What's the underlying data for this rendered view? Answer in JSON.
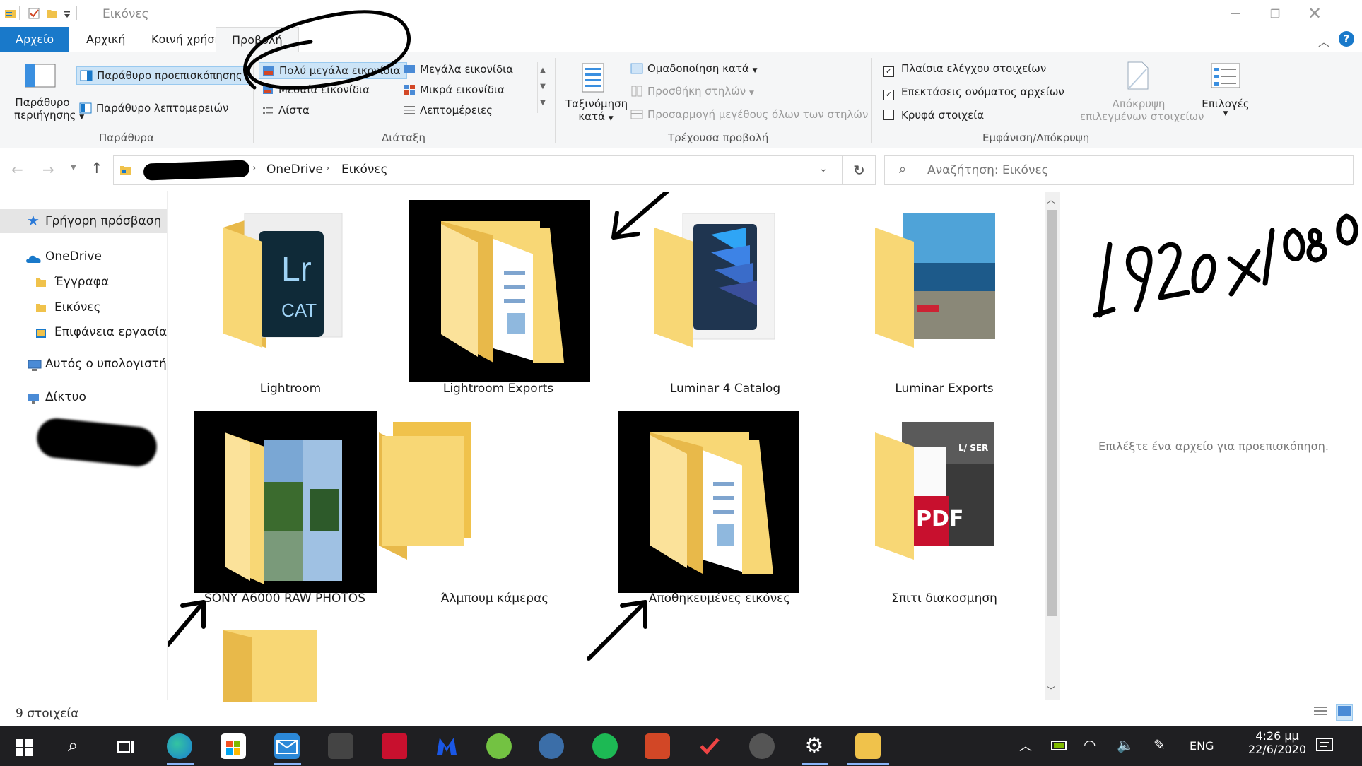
{
  "window": {
    "title": "Εικόνες",
    "help": "?"
  },
  "tabs": {
    "file": "Αρχείο",
    "home": "Αρχική",
    "share": "Κοινή χρήση",
    "view": "Προβολή"
  },
  "ribbon": {
    "panes": {
      "nav_pane_line1": "Παράθυρο",
      "nav_pane_line2": "περιήγησης",
      "preview_pane": "Παράθυρο προεπισκόπησης",
      "details_pane": "Παράθυρο λεπτομερειών",
      "group": "Παράθυρα"
    },
    "layout": {
      "xl_icons": "Πολύ μεγάλα εικονίδια",
      "large_icons": "Μεγάλα εικονίδια",
      "medium_icons": "Μεσαία εικονίδια",
      "small_icons": "Μικρά εικονίδια",
      "list": "Λίστα",
      "details": "Λεπτομέρειες",
      "group": "Διάταξη"
    },
    "current_view": {
      "sort_line1": "Ταξινόμηση",
      "sort_line2": "κατά",
      "group_by": "Ομαδοποίηση κατά",
      "add_columns": "Προσθήκη στηλών",
      "size_columns": "Προσαρμογή μεγέθους όλων των στηλών",
      "group": "Τρέχουσα προβολή"
    },
    "show_hide": {
      "item_checkboxes": "Πλαίσια ελέγχου στοιχείων",
      "item_checkboxes_checked": true,
      "extensions": "Επεκτάσεις ονόματος αρχείων",
      "extensions_checked": true,
      "hidden": "Κρυφά στοιχεία",
      "hidden_checked": false,
      "hide_selected_line1": "Απόκρυψη",
      "hide_selected_line2": "επιλεγμένων στοιχείων",
      "group": "Εμφάνιση/Απόκρυψη"
    },
    "options": "Επιλογές"
  },
  "address": {
    "crumbs": [
      "OneDrive",
      "Εικόνες"
    ],
    "search_placeholder": "Αναζήτηση: Εικόνες"
  },
  "nav_pane": {
    "quick_access": "Γρήγορη πρόσβαση",
    "onedrive": "OneDrive",
    "documents": "Έγγραφα",
    "pictures": "Εικόνες",
    "desktop": "Επιφάνεια εργασίας",
    "this_pc": "Αυτός ο υπολογιστής",
    "network": "Δίκτυο"
  },
  "folders": [
    {
      "name": "Lightroom"
    },
    {
      "name": "Lightroom Exports"
    },
    {
      "name": "Luminar 4 Catalog"
    },
    {
      "name": "Luminar Exports"
    },
    {
      "name": "SONY A6000 RAW PHOTOS"
    },
    {
      "name": "Άλμπουμ κάμερας"
    },
    {
      "name": "Αποθηκευμένες εικόνες"
    },
    {
      "name": "Σπιτι διακοσμηση"
    }
  ],
  "thumb_text": {
    "lr_top": "Lr",
    "lr_bottom": "CAT",
    "pdf": "PDF",
    "magazine": "L/ SER"
  },
  "preview": {
    "message": "Επιλέξτε ένα αρχείο για προεπισκόπηση."
  },
  "annotation": {
    "resolution": "1920x1080"
  },
  "status": {
    "items": "9 στοιχεία"
  },
  "taskbar": {
    "lang": "ENG",
    "time": "4:26 μμ",
    "date": "22/6/2020"
  },
  "colors": {
    "accent": "#1979ca",
    "folder": "#f8d775",
    "taskbar": "#1f1f22"
  }
}
